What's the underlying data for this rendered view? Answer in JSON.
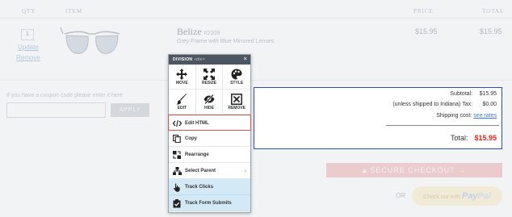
{
  "table_headers": {
    "qty": "QTY",
    "item": "ITEM",
    "price": "PRICE",
    "total": "TOTAL"
  },
  "cart_item": {
    "quantity": "1",
    "update": "Update",
    "remove": "Remove",
    "name": "Belize",
    "sku": "#2009",
    "description": "Grey Frame with Blue Mirrored Lenses",
    "price": "$15.95",
    "total": "$15.95",
    "image": "sunglasses-image"
  },
  "coupon": {
    "label": "If you have a coupon code please enter it here",
    "value": "",
    "apply_label": "APPLY"
  },
  "totals": {
    "subtotal_label": "Subtotal:",
    "subtotal_value": "$15.95",
    "tax_label": "(unless shipped to Indiana) Tax:",
    "tax_value": "$0.00",
    "shipping_label": "Shipping cost:",
    "shipping_link": "see rates",
    "total_label": "Total:",
    "total_value": "$15.95"
  },
  "checkout": {
    "label": "SECURE CHECKOUT →",
    "icon": "lock-icon"
  },
  "or_label": "OR",
  "paypal": {
    "prefix": "Check out with",
    "brand_a": "Pay",
    "brand_b": "Pal"
  },
  "division_menu": {
    "title": "DIVISION",
    "subtitle": "<div>",
    "close": "×",
    "tools": [
      {
        "label": "MOVE",
        "icon": "move-icon"
      },
      {
        "label": "RESIZE",
        "icon": "resize-icon"
      },
      {
        "label": "STYLE",
        "icon": "palette-icon"
      },
      {
        "label": "EDIT",
        "icon": "brush-icon"
      },
      {
        "label": "HIDE",
        "icon": "eye-slash-icon"
      },
      {
        "label": "REMOVE",
        "icon": "remove-box-icon"
      }
    ],
    "actions": [
      {
        "label": "Edit HTML",
        "icon": "code-icon"
      },
      {
        "label": "Copy",
        "icon": "copy-icon"
      },
      {
        "label": "Rearrange",
        "icon": "rearrange-icon"
      },
      {
        "label": "Select Parent",
        "icon": "hierarchy-icon"
      },
      {
        "label": "Track Clicks",
        "icon": "click-icon"
      },
      {
        "label": "Track Form Submits",
        "icon": "form-check-icon"
      }
    ]
  },
  "colors": {
    "highlight_border": "#2b4fb0",
    "total_red": "#e2231a",
    "menu_header": "#4d5560",
    "selected_border": "#d9534f",
    "tracking_bg": "#d3eaf6"
  }
}
